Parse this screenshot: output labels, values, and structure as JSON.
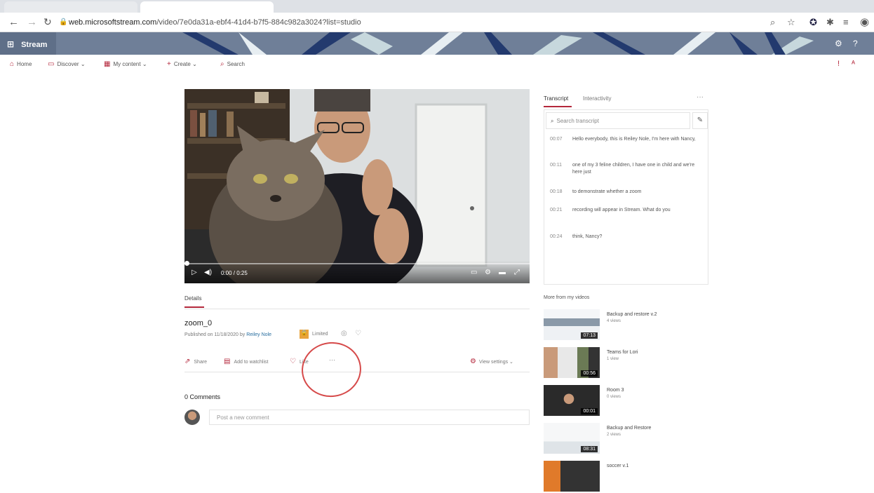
{
  "browser": {
    "tabs": [
      "",
      ""
    ],
    "url_host": "web.microsoftstream.com",
    "url_path": "/video/7e0da31a-ebf4-41d4-b7f5-884c982a3024?list=studio"
  },
  "banner": {
    "app_name": "Stream"
  },
  "nav": {
    "home": "Home",
    "discover": "Discover",
    "my_content": "My content",
    "create": "Create",
    "search": "Search"
  },
  "player": {
    "time": "0:00 / 0:25",
    "progress": 0
  },
  "details": {
    "tab_label": "Details",
    "video_title": "zoom_0",
    "published_prefix": "Published on 11/18/2020 by",
    "owner": "Reiley Nole",
    "privacy": "Limited",
    "actions": {
      "share": "Share",
      "watchlist": "Add to watchlist",
      "like": "Like",
      "more": "···",
      "view_settings": "View settings"
    }
  },
  "comments": {
    "title": "0 Comments",
    "placeholder": "Post a new comment"
  },
  "transcript": {
    "tab_transcript": "Transcript",
    "tab_interactivity": "Interactivity",
    "more": "···",
    "search_placeholder": "Search transcript",
    "lines": [
      {
        "time": "00:07",
        "text": "Hello everybody, this is Reiley Nole, I'm here with Nancy,"
      },
      {
        "time": "00:11",
        "text": "one of my 3 feline children, I have one in child and we're here just"
      },
      {
        "time": "00:18",
        "text": "to demonstrate whether a zoom"
      },
      {
        "time": "00:21",
        "text": "recording will appear in Stream. What do you"
      },
      {
        "time": "00:24",
        "text": "think, Nancy?"
      }
    ]
  },
  "more_videos": {
    "title": "More from my videos",
    "items": [
      {
        "name": "Backup and restore v.2",
        "views": "4 views",
        "duration": "07:13"
      },
      {
        "name": "Teams for Lori",
        "views": "1 view",
        "duration": "00:56"
      },
      {
        "name": "Room 3",
        "views": "0 views",
        "duration": "00:01"
      },
      {
        "name": "Backup and Restore",
        "views": "2 views",
        "duration": "08:31"
      },
      {
        "name": "soccer v.1",
        "views": "",
        "duration": ""
      }
    ]
  },
  "colors": {
    "accent": "#b4283c",
    "annotation": "#d64a4a"
  }
}
